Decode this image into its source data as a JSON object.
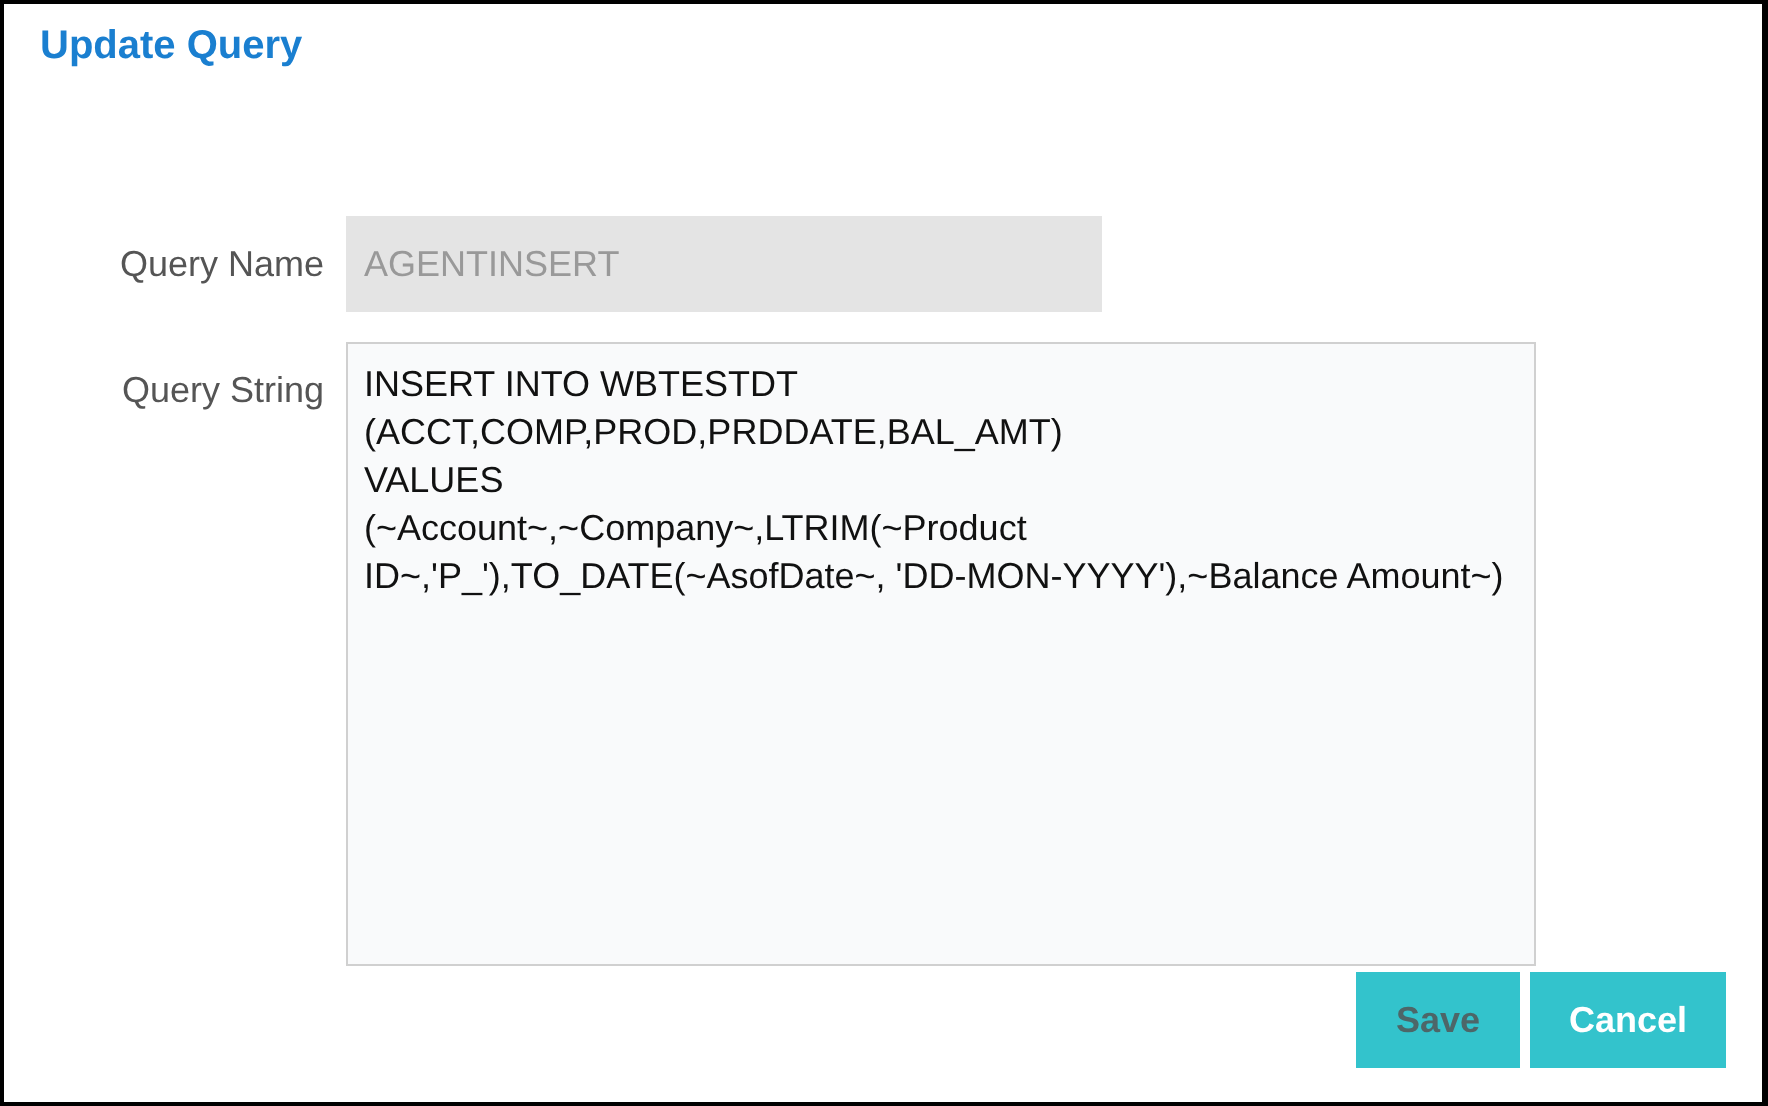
{
  "dialog": {
    "title": "Update Query"
  },
  "fields": [
    {
      "kind": "text",
      "label": "Query Name",
      "value": "AGENTINSERT",
      "disabled": true
    },
    {
      "kind": "textarea",
      "label": "Query String",
      "value": "INSERT INTO WBTESTDT\n(ACCT,COMP,PROD,PRDDATE,BAL_AMT)\nVALUES\n(~Account~,~Company~,LTRIM(~Product ID~,'P_'),TO_DATE(~AsofDate~, 'DD-MON-YYYY'),~Balance Amount~)",
      "disabled": false
    }
  ],
  "buttons": [
    {
      "label": "Save",
      "disabled": true
    },
    {
      "label": "Cancel",
      "disabled": false
    }
  ]
}
